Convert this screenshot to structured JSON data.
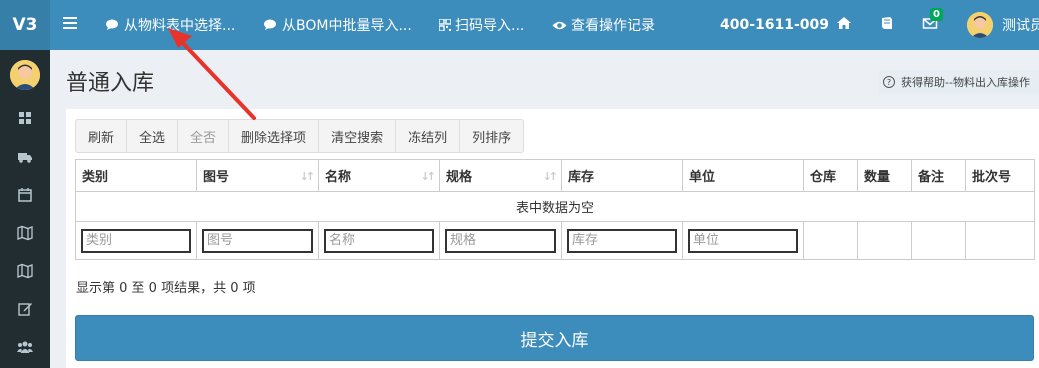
{
  "header": {
    "logo": "V3",
    "links": [
      {
        "label": "从物料表中选择...",
        "icon": "comments-icon"
      },
      {
        "label": "从BOM中批量导入...",
        "icon": "comments-icon"
      },
      {
        "label": "扫码导入...",
        "icon": "qrcode-icon"
      },
      {
        "label": "查看操作记录",
        "icon": "eye-icon"
      }
    ],
    "phone": "400-1611-009",
    "mail_badge": "0",
    "user_name": "测试员"
  },
  "sidebar": {
    "icons": [
      "dashboard-icon",
      "truck-icon",
      "calendar-icon",
      "map-icon",
      "map-icon-2",
      "edit-icon",
      "users-icon"
    ]
  },
  "page": {
    "title": "普通入库",
    "help": "获得帮助--物料出入库操作"
  },
  "toolbar": {
    "buttons": [
      "刷新",
      "全选",
      "全否",
      "删除选择项",
      "清空搜索",
      "冻结列",
      "列排序"
    ]
  },
  "table": {
    "columns": [
      "类别",
      "图号",
      "名称",
      "规格",
      "库存",
      "单位",
      "仓库",
      "数量",
      "备注",
      "批次号"
    ],
    "empty_text": "表中数据为空",
    "filters": [
      "类别",
      "图号",
      "名称",
      "规格",
      "库存",
      "单位"
    ]
  },
  "info": "显示第 0 至 0 项结果，共 0 项",
  "submit_label": "提交入库",
  "colors": {
    "primary": "#3c8dbc",
    "sidebar": "#222d32",
    "arrow": "#e8332a"
  }
}
